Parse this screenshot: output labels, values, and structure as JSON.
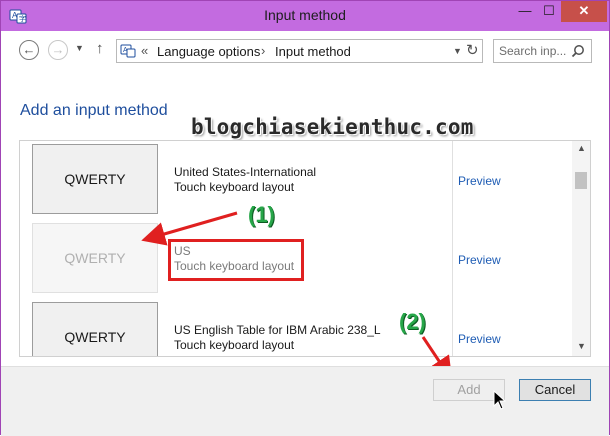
{
  "window": {
    "title": "Input method",
    "minimize_label": "—",
    "maximize_label": "☐",
    "close_label": "✕"
  },
  "nav": {
    "back_label": "←",
    "forward_label": "→",
    "recent_label": "▼",
    "up_label": "↑",
    "breadcrumb_sep": "«",
    "crumbs": [
      "Language options",
      "Input method"
    ],
    "crumb_arrow": "›",
    "address_dropdown": "▼",
    "refresh_label": "↻",
    "search_placeholder": "Search inp..."
  },
  "main": {
    "title": "Add an input method",
    "watermark": "blogchiasekienthuc.com",
    "rows": [
      {
        "button_label": "QWERTY",
        "line1": "United States-International",
        "line2": "Touch keyboard layout",
        "preview": "Preview",
        "disabled": false
      },
      {
        "button_label": "QWERTY",
        "line1": "US",
        "line2": "Touch keyboard layout",
        "preview": "Preview",
        "disabled": true
      },
      {
        "button_label": "QWERTY",
        "line1": "US English Table for IBM Arabic 238_L",
        "line2": "Touch keyboard layout",
        "preview": "Preview",
        "disabled": false
      }
    ]
  },
  "annotations": {
    "step1": "(1)",
    "step2": "(2)",
    "color_red": "#e02020",
    "color_green": "#27a649"
  },
  "footer": {
    "add_label": "Add",
    "cancel_label": "Cancel"
  },
  "colors": {
    "titlebar": "#c36be0",
    "close_button": "#c7504a",
    "link": "#1e5cb4",
    "heading": "#1e4e9d"
  }
}
